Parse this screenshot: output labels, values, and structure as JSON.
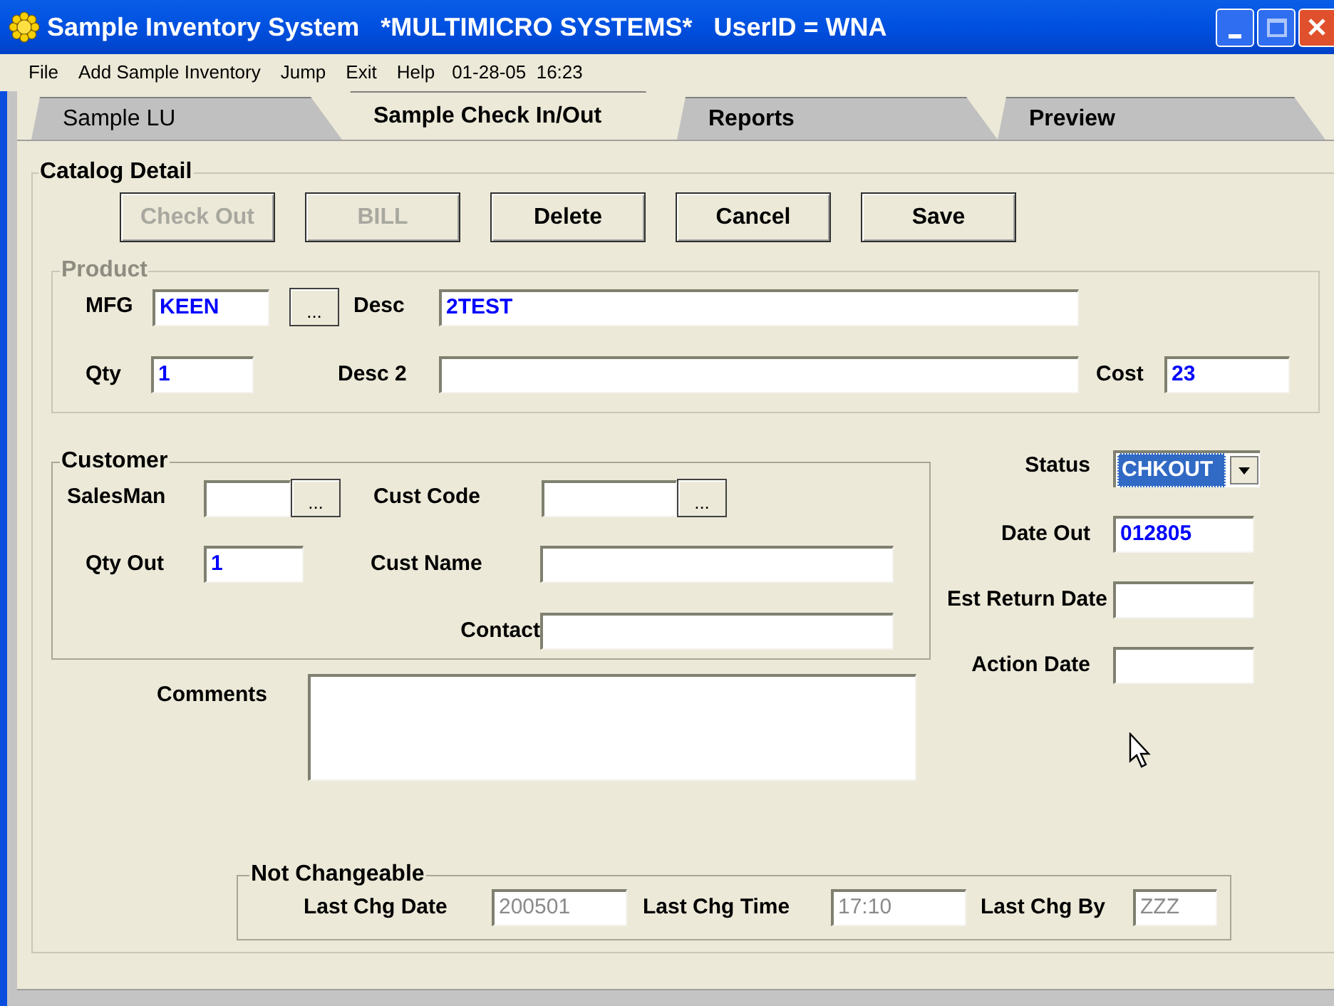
{
  "window": {
    "title": "Sample Inventory System   *MULTIMICRO SYSTEMS*   UserID = WNA"
  },
  "menu": [
    {
      "label": "File"
    },
    {
      "label": "Add Sample Inventory"
    },
    {
      "label": "Jump"
    },
    {
      "label": "Exit"
    },
    {
      "label": "Help"
    }
  ],
  "menu_datetime": "01-28-05  16:23",
  "tabs": [
    {
      "label": "Sample LU",
      "selected": false
    },
    {
      "label": "Sample Check In/Out",
      "selected": true
    },
    {
      "label": "Reports",
      "selected": false
    },
    {
      "label": "Preview",
      "selected": false
    }
  ],
  "catalog_detail": {
    "title": "Catalog Detail",
    "buttons": [
      {
        "label": "Check Out",
        "disabled": true
      },
      {
        "label": "BILL",
        "disabled": true
      },
      {
        "label": "Delete",
        "disabled": false
      },
      {
        "label": "Cancel",
        "disabled": false
      },
      {
        "label": "Save",
        "disabled": false
      }
    ]
  },
  "product": {
    "title": "Product",
    "disabled": true,
    "mfg": {
      "label": "MFG",
      "value": "KEEN",
      "button": "..."
    },
    "desc": {
      "label": "Desc",
      "value": "2TEST"
    },
    "qty": {
      "label": "Qty",
      "value": "1"
    },
    "desc2": {
      "label": "Desc 2"
    },
    "cost": {
      "label": "Cost",
      "value": "23"
    }
  },
  "customer": {
    "title": "Customer",
    "salesman": {
      "label": "SalesMan",
      "button": "..."
    },
    "cust_code": {
      "label": "Cust Code",
      "button": "..."
    },
    "qty_out": {
      "label": "Qty Out",
      "value": "1"
    },
    "cust_name": {
      "label": "Cust Name"
    },
    "contact": {
      "label": "Contact"
    }
  },
  "comments": {
    "label": "Comments"
  },
  "status": {
    "label": "Status",
    "value": "CHKOUT"
  },
  "date_out": {
    "label": "Date Out",
    "value": "012805"
  },
  "est_return_date": {
    "label": "Est Return Date"
  },
  "action_date": {
    "label": "Action Date"
  },
  "not_changeable": {
    "title": "Not Changeable",
    "fields": [
      {
        "label": "Last Chg Date",
        "value": "200501"
      },
      {
        "label": "Last Chg Time",
        "value": "17:10"
      },
      {
        "label": "Last Chg By",
        "value": "ZZZ"
      }
    ]
  }
}
